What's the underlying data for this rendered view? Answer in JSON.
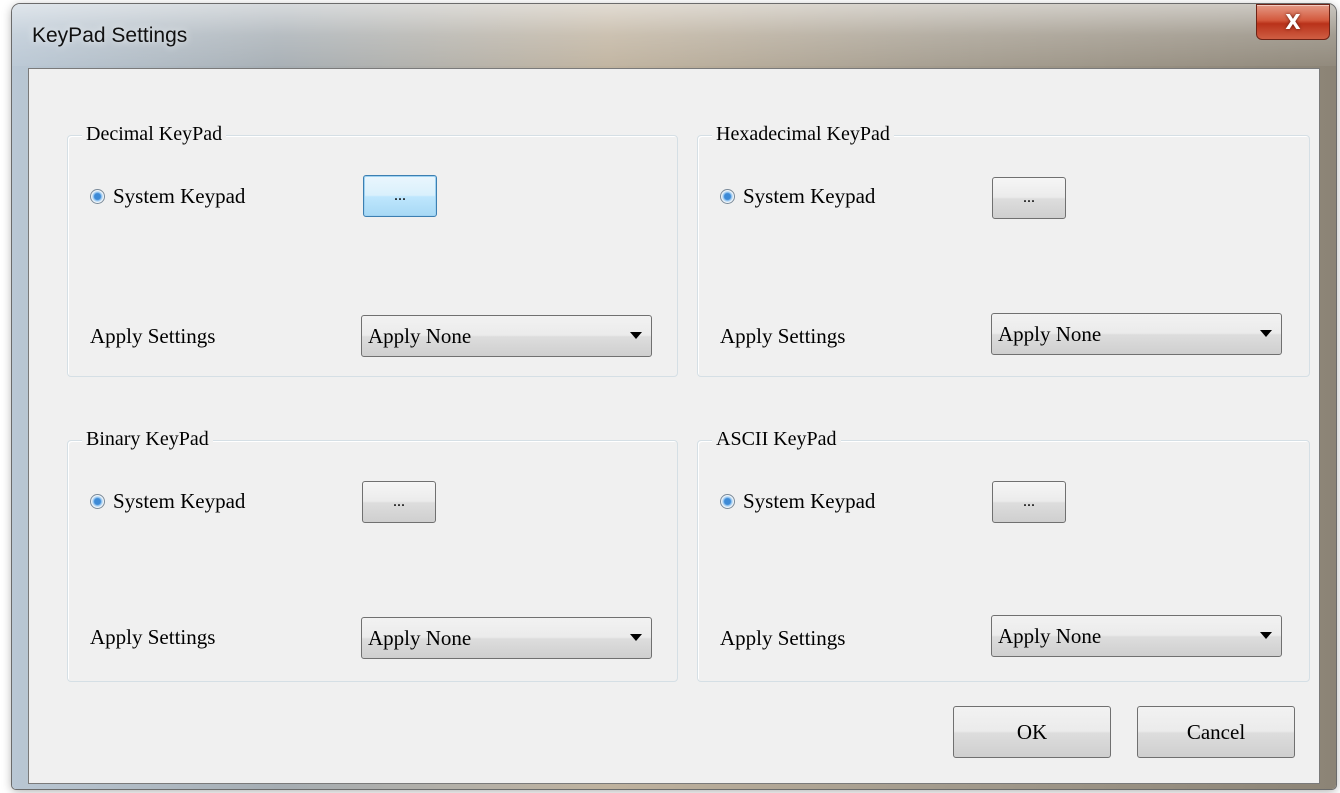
{
  "window": {
    "title": "KeyPad Settings",
    "close_label": "X"
  },
  "groups": [
    {
      "legend": "Decimal KeyPad",
      "radio_label": "System Keypad",
      "radio_selected": true,
      "ellipsis_label": "...",
      "apply_label": "Apply Settings",
      "apply_value": "Apply None"
    },
    {
      "legend": "Hexadecimal KeyPad",
      "radio_label": "System Keypad",
      "radio_selected": true,
      "ellipsis_label": "...",
      "apply_label": "Apply Settings",
      "apply_value": "Apply None"
    },
    {
      "legend": "Binary KeyPad",
      "radio_label": "System Keypad",
      "radio_selected": true,
      "ellipsis_label": "...",
      "apply_label": "Apply Settings",
      "apply_value": "Apply None"
    },
    {
      "legend": "ASCII KeyPad",
      "radio_label": "System Keypad",
      "radio_selected": true,
      "ellipsis_label": "...",
      "apply_label": "Apply Settings",
      "apply_value": "Apply None"
    }
  ],
  "buttons": {
    "ok_label": "OK",
    "cancel_label": "Cancel"
  },
  "colors": {
    "close_button": "#c8452c",
    "radio_selected": "#3d8ad6",
    "focused_button_border": "#3c7fb1",
    "dialog_background": "#f0f0f0"
  }
}
